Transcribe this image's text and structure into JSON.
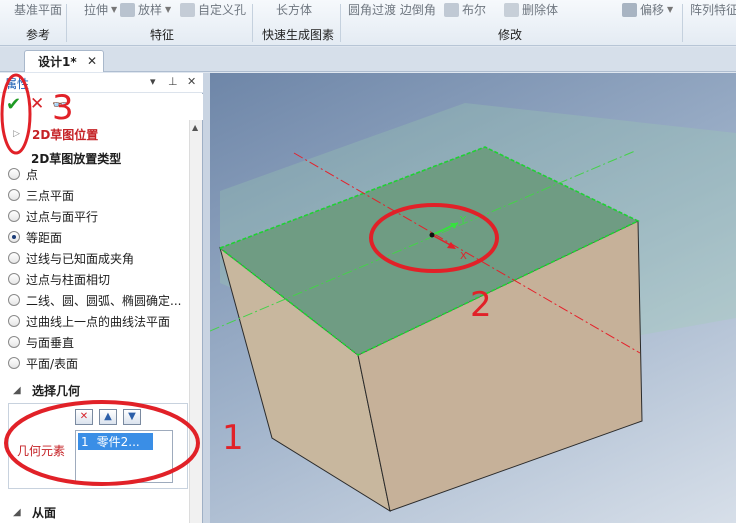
{
  "ribbon": {
    "top_buttons": [
      {
        "name": "ref-plane-button",
        "label": "基准平面"
      },
      {
        "name": "extrude-button",
        "label": "拉伸"
      },
      {
        "name": "loft-button",
        "label": "放样"
      },
      {
        "name": "custom-hole-button",
        "label": "自定义孔"
      },
      {
        "name": "box-button",
        "label": "长方体"
      },
      {
        "name": "fillet-button",
        "label": "圆角过渡 边倒角"
      },
      {
        "name": "boolean-button",
        "label": "布尔"
      },
      {
        "name": "delete-body-button",
        "label": "删除体"
      },
      {
        "name": "offset-button",
        "label": "偏移"
      },
      {
        "name": "array-button",
        "label": "阵列特征"
      }
    ],
    "groups": [
      "参考",
      "特征",
      "快速生成图素",
      "修改"
    ]
  },
  "tabs": [
    {
      "label": "设计1*"
    }
  ],
  "panel": {
    "title": "属性",
    "section_2d": "2D草图位置",
    "placement_type_label": "2D草图放置类型",
    "placement_options": [
      {
        "label": "点",
        "selected": false
      },
      {
        "label": "三点平面",
        "selected": false
      },
      {
        "label": "过点与面平行",
        "selected": false
      },
      {
        "label": "等距面",
        "selected": true
      },
      {
        "label": "过线与已知面成夹角",
        "selected": false
      },
      {
        "label": "过点与柱面相切",
        "selected": false
      },
      {
        "label": "二线、圆、圆弧、椭圆确定...",
        "selected": false
      },
      {
        "label": "过曲线上一点的曲线法平面",
        "selected": false
      },
      {
        "label": "与面垂直",
        "selected": false
      },
      {
        "label": "平面/表面",
        "selected": false
      }
    ],
    "section_geometry": "选择几何",
    "geometry_label": "几何元素",
    "geometry_items": [
      {
        "index": "1",
        "name": "零件2..."
      }
    ],
    "section_from": "从面"
  },
  "viewport": {
    "axis_x": "X",
    "axis_y": "Y"
  },
  "annotations": {
    "n1": "1",
    "n2": "2",
    "n3": "3",
    "color": "#e12128"
  },
  "colors": {
    "accent": "#1a5fb4",
    "red_label": "#c52226",
    "selection": "#3a8ee6",
    "ok": "#1e9a24"
  }
}
